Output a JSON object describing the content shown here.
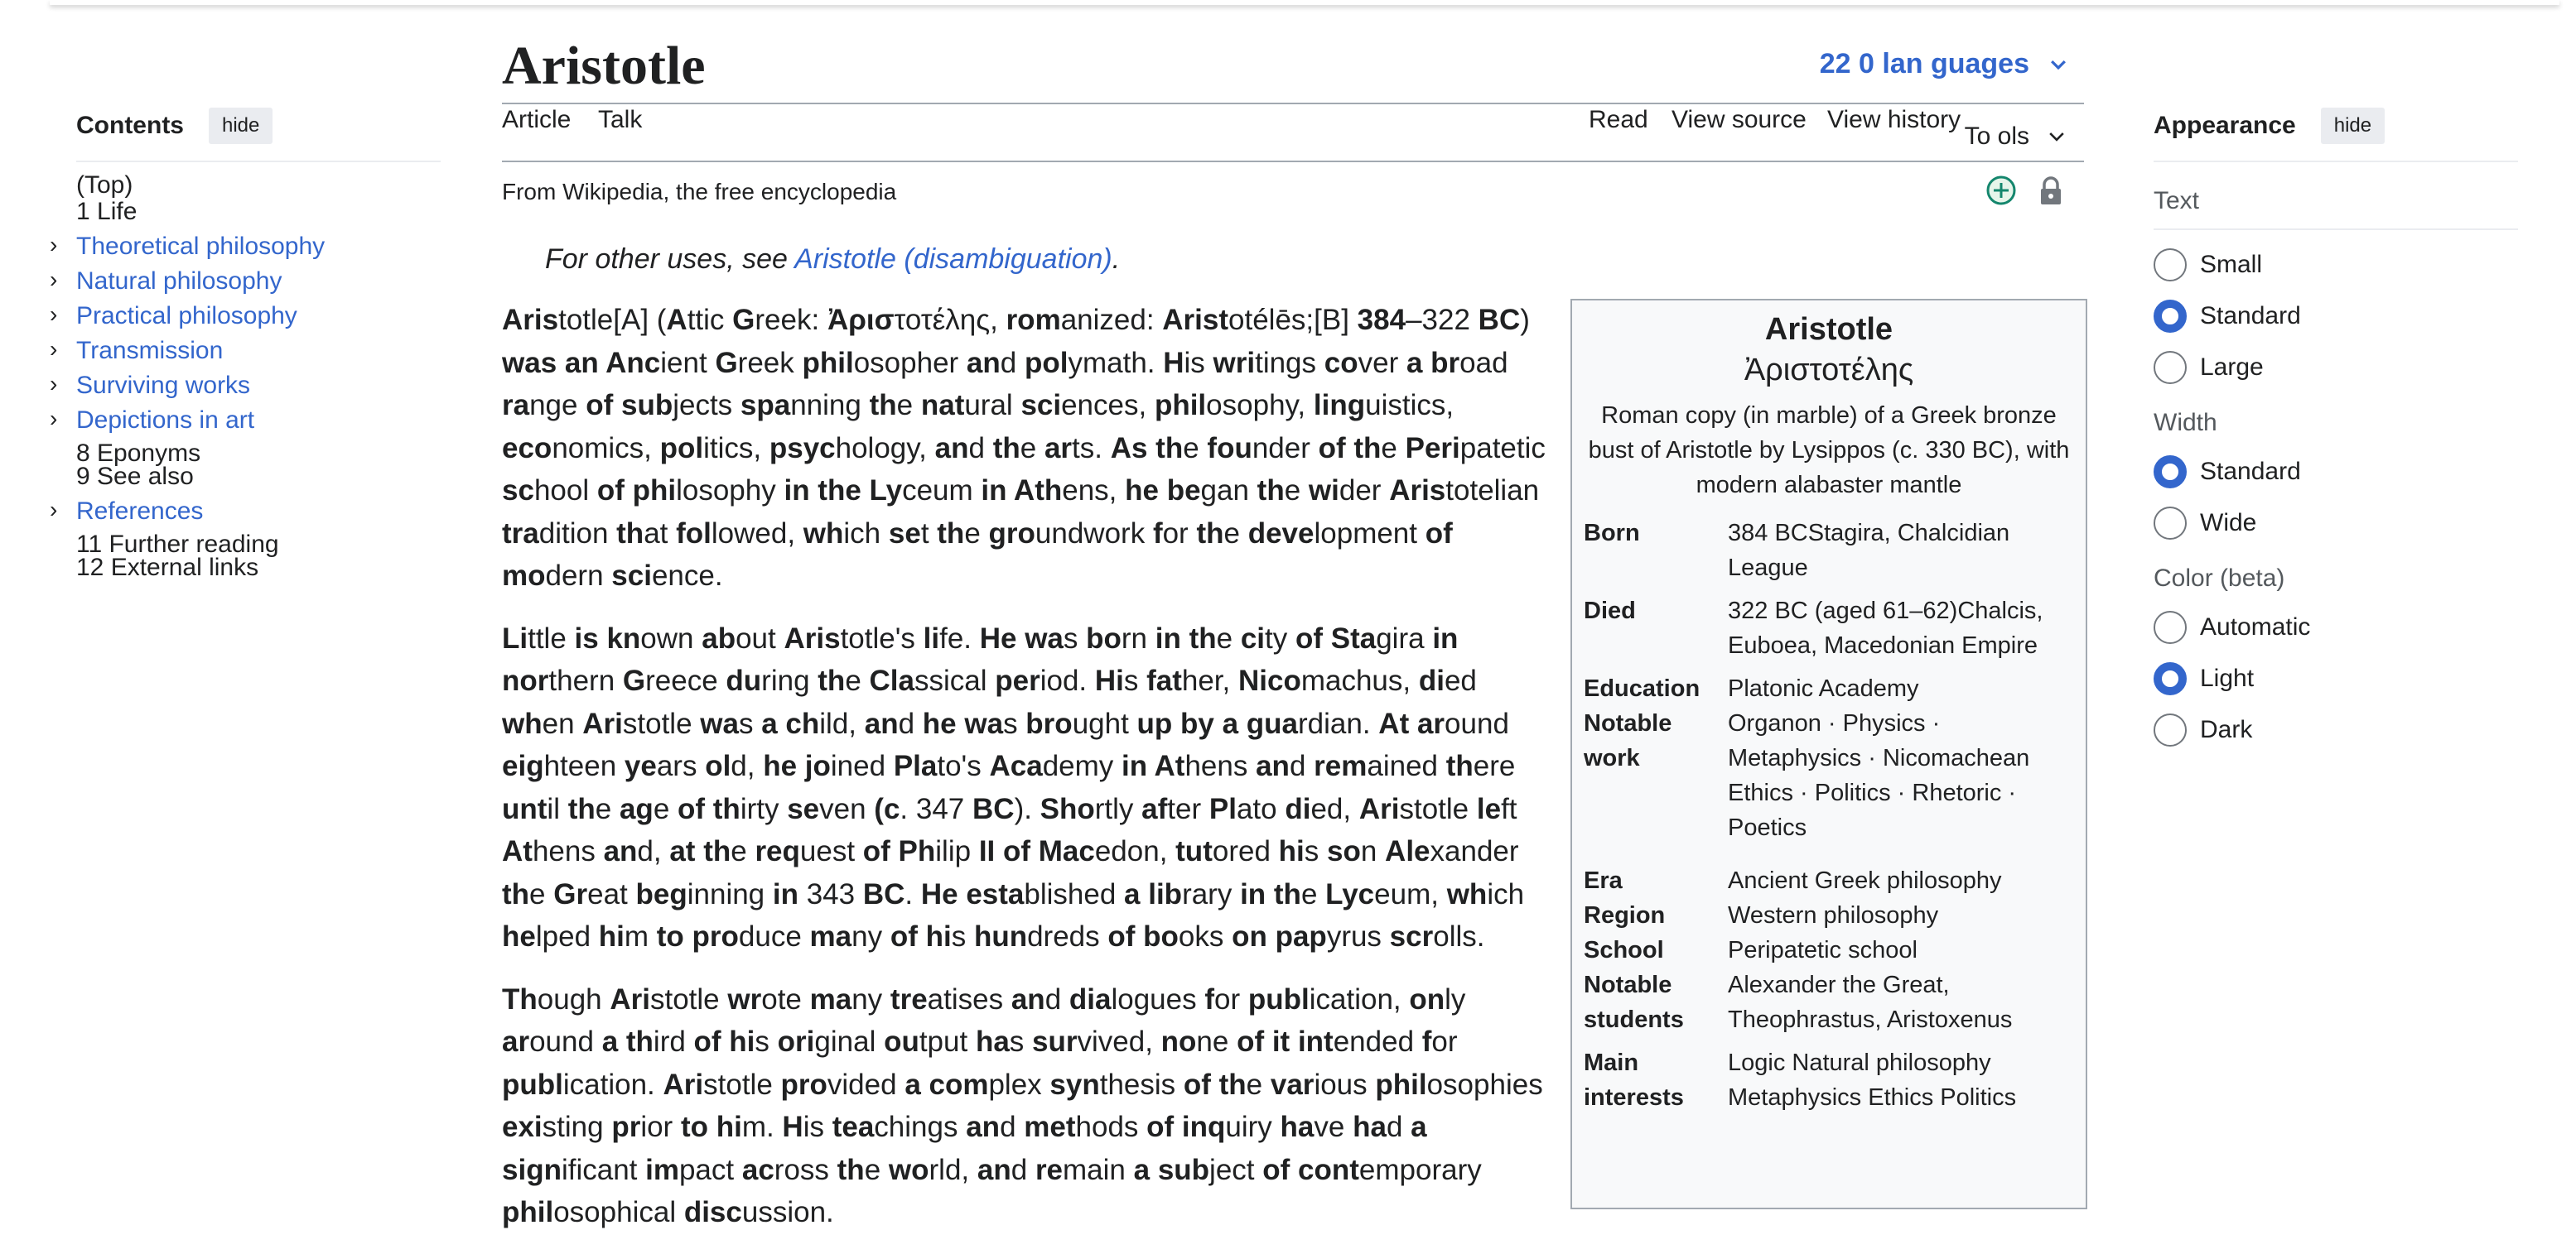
{
  "toc": {
    "title": "Contents",
    "hide": "hide",
    "items": [
      {
        "label": "(Top)",
        "link": false
      },
      {
        "label": "1 Life",
        "link": false
      },
      {
        "label": "Theoretical philosophy",
        "link": true
      },
      {
        "label": "Natural philosophy",
        "link": true
      },
      {
        "label": "Practical philosophy",
        "link": true
      },
      {
        "label": "Transmission",
        "link": true
      },
      {
        "label": "Surviving works",
        "link": true
      },
      {
        "label": "Depictions in art",
        "link": true
      },
      {
        "label": "8 Eponyms",
        "link": false
      },
      {
        "label": "9 See also",
        "link": false
      },
      {
        "label": "References",
        "link": true
      },
      {
        "label": "11 Further reading",
        "link": false
      },
      {
        "label": "12 External links",
        "link": false
      }
    ]
  },
  "header": {
    "title_bold": "Ari",
    "title_rest": "stotle",
    "languages": "22 0 lan guages",
    "tabs": {
      "article": "Article",
      "talk": "Talk",
      "read": "Read",
      "view_source": "View source",
      "view_history": "View history",
      "tools": "To ols"
    },
    "tagline": "From Wikipedia, the free encyclopedia"
  },
  "hatnote": {
    "prefix": "For other uses, see ",
    "link": "Aristotle (disambiguation)",
    "suffix": "."
  },
  "infobox": {
    "title": "Aristotle",
    "native": "Ἀριστοτέλης",
    "caption": "Roman copy (in marble) of a Greek bronze bust of Aristotle by Lysippos (c. 330 BC), with modern alabaster mantle",
    "rows": [
      {
        "label": "Born",
        "value": "384 BCStagira, Chalcidian League"
      },
      {
        "label": "Died",
        "value": "322 BC (aged 61–62)Chalcis, Euboea, Macedonian Empire"
      },
      {
        "label": "Education",
        "value": "Platonic Academy"
      },
      {
        "label": "Notable work",
        "value": "Organon · Physics · Metaphysics · Nicomachean Ethics · Politics · Rhetoric · Poetics"
      },
      {
        "label": "Era",
        "value": "Ancient Greek philosophy"
      },
      {
        "label": "Region",
        "value": "Western philosophy"
      },
      {
        "label": "School",
        "value": "Peripatetic school"
      },
      {
        "label": "Notable students",
        "value": "Alexander the Great, Theophrastus, Aristoxenus"
      },
      {
        "label": "Main interests",
        "value": "Logic Natural philosophy Metaphysics Ethics Politics"
      }
    ]
  },
  "appearance": {
    "title": "Appearance",
    "hide": "hide",
    "text_label": "Text",
    "text_options": [
      "Small",
      "Standard",
      "Large"
    ],
    "text_selected": 1,
    "width_label": "Width",
    "width_options": [
      "Standard",
      "Wide"
    ],
    "width_selected": 0,
    "color_label": "Color (beta)",
    "color_options": [
      "Automatic",
      "Light",
      "Dark"
    ],
    "color_selected": 1
  },
  "colors": {
    "link": "#3366cc",
    "radio_checked": "#3366cc"
  }
}
